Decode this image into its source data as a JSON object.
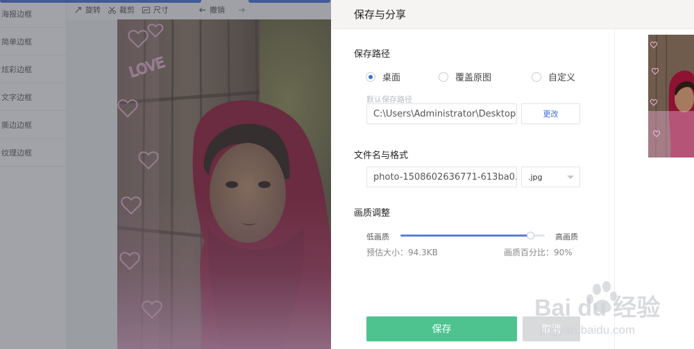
{
  "sidebar": {
    "items": [
      {
        "label": "海报边框"
      },
      {
        "label": "简单边框"
      },
      {
        "label": "炫彩边框"
      },
      {
        "label": "文字边框"
      },
      {
        "label": "撕边边框"
      },
      {
        "label": "纹理边框"
      }
    ]
  },
  "toolbar": {
    "rotate": "旋转",
    "crop": "裁剪",
    "size": "尺寸",
    "undo": "撤销"
  },
  "image": {
    "overlay_text": "LOVE"
  },
  "dialog": {
    "title": "保存与分享",
    "save_path": {
      "title": "保存路径",
      "options": [
        "桌面",
        "覆盖原图",
        "自定义"
      ],
      "selected": "桌面",
      "hint": "默认保存路径",
      "path_value": "C:\\Users\\Administrator\\Desktop",
      "change_button": "更改"
    },
    "filename": {
      "title": "文件名与格式",
      "value": "photo-1508602636771-613ba0...",
      "format": ".jpg"
    },
    "quality": {
      "title": "画质调整",
      "low_label": "低画质",
      "high_label": "高画质",
      "value_percent": 90,
      "estimate_label": "预估大小：94.3KB",
      "percent_label": "画质百分比：90%"
    },
    "buttons": {
      "save": "保存",
      "cancel": "取消"
    }
  },
  "watermark": {
    "brand": "Bai du 经验",
    "url": "jingyan.baidu.com"
  },
  "colors": {
    "accent": "#3f6bd8",
    "save_button": "#4ec390",
    "scarf": "#8e1232"
  }
}
